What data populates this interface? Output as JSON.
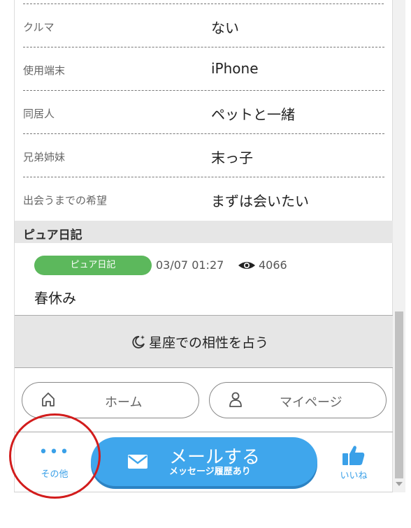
{
  "profile": {
    "rows": [
      {
        "label": "クルマ",
        "value": "ない"
      },
      {
        "label": "使用端末",
        "value": "iPhone"
      },
      {
        "label": "同居人",
        "value": "ペットと一緒"
      },
      {
        "label": "兄弟姉妹",
        "value": "末っ子"
      },
      {
        "label": "出会うまでの希望",
        "value": "まずは会いたい"
      }
    ]
  },
  "diary": {
    "section_title": "ピュア日記",
    "badge": "ピュア日記",
    "date": "03/07 01:27",
    "views": "4066",
    "entry_title": "春休み"
  },
  "horoscope": {
    "label": "星座での相性を占う"
  },
  "nav": {
    "home_label": "ホーム",
    "mypage_label": "マイページ"
  },
  "bottom_bar": {
    "other_dots": "•••",
    "other_label": "その他",
    "mail_label": "メールする",
    "mail_sub": "メッセージ履歴あり",
    "like_label": "いいね"
  },
  "colors": {
    "accent": "#3fa6ec",
    "diary_badge": "#5cb85c",
    "annotation_circle": "#d21c1c"
  }
}
